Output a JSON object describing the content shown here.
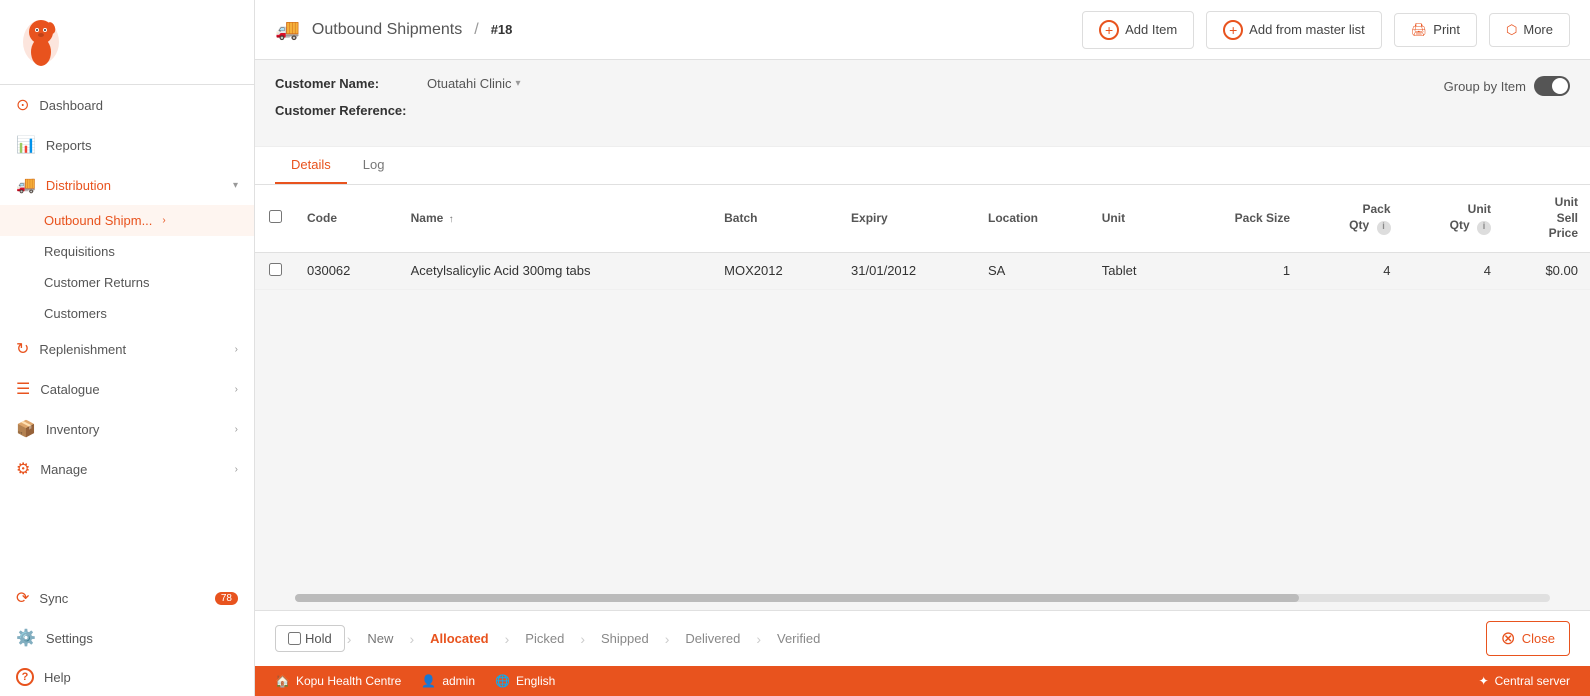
{
  "app": {
    "logo_alt": "mSupply logo"
  },
  "sidebar": {
    "items": [
      {
        "id": "dashboard",
        "label": "Dashboard",
        "icon": "⊙",
        "active": false
      },
      {
        "id": "reports",
        "label": "Reports",
        "icon": "📊",
        "active": false
      },
      {
        "id": "distribution",
        "label": "Distribution",
        "icon": "🚚",
        "active": true,
        "expanded": true
      },
      {
        "id": "replenishment",
        "label": "Replenishment",
        "icon": "🔄",
        "active": false
      },
      {
        "id": "catalogue",
        "label": "Catalogue",
        "icon": "☰",
        "active": false
      },
      {
        "id": "inventory",
        "label": "Inventory",
        "icon": "📦",
        "active": false
      },
      {
        "id": "manage",
        "label": "Manage",
        "icon": "⚙",
        "active": false
      },
      {
        "id": "sync",
        "label": "Sync",
        "icon": "⟳",
        "active": false,
        "badge": "78"
      },
      {
        "id": "settings",
        "label": "Settings",
        "icon": "⚙️",
        "active": false
      },
      {
        "id": "help",
        "label": "Help",
        "icon": "?",
        "active": false
      }
    ],
    "sub_items": [
      {
        "id": "outbound",
        "label": "Outbound Shipm...",
        "active": true
      },
      {
        "id": "requisitions",
        "label": "Requisitions",
        "active": false
      },
      {
        "id": "customer_returns",
        "label": "Customer Returns",
        "active": false
      },
      {
        "id": "customers",
        "label": "Customers",
        "active": false
      }
    ]
  },
  "header": {
    "breadcrumb_parent": "Outbound Shipments",
    "separator": "/",
    "shipment_id": "#18",
    "buttons": {
      "add_item": "Add Item",
      "add_from_master": "Add from master list",
      "print": "Print",
      "more": "More"
    }
  },
  "form": {
    "customer_name_label": "Customer Name:",
    "customer_name_value": "Otuatahi Clinic",
    "customer_ref_label": "Customer Reference:",
    "group_by_label": "Group by Item"
  },
  "tabs": [
    {
      "id": "details",
      "label": "Details",
      "active": true
    },
    {
      "id": "log",
      "label": "Log",
      "active": false
    }
  ],
  "table": {
    "columns": [
      {
        "id": "checkbox",
        "label": "",
        "type": "checkbox"
      },
      {
        "id": "code",
        "label": "Code"
      },
      {
        "id": "name",
        "label": "Name",
        "sortable": true
      },
      {
        "id": "batch",
        "label": "Batch"
      },
      {
        "id": "expiry",
        "label": "Expiry"
      },
      {
        "id": "location",
        "label": "Location"
      },
      {
        "id": "unit",
        "label": "Unit"
      },
      {
        "id": "pack_size",
        "label": "Pack Size"
      },
      {
        "id": "pack_qty",
        "label": "Pack Qty",
        "info": true
      },
      {
        "id": "unit_qty",
        "label": "Unit Qty",
        "info": true
      },
      {
        "id": "unit_sell_price",
        "label": "Unit Sell Price"
      }
    ],
    "rows": [
      {
        "code": "030062",
        "name": "Acetylsalicylic Acid 300mg tabs",
        "batch": "MOX2012",
        "expiry": "31/01/2012",
        "location": "SA",
        "unit": "Tablet",
        "pack_size": "1",
        "pack_qty": "4",
        "unit_qty": "4",
        "unit_sell_price": "$0.00"
      }
    ]
  },
  "status_pipeline": {
    "hold_label": "Hold",
    "steps": [
      {
        "id": "new",
        "label": "New",
        "state": "completed"
      },
      {
        "id": "allocated",
        "label": "Allocated",
        "state": "active"
      },
      {
        "id": "picked",
        "label": "Picked",
        "state": "default"
      },
      {
        "id": "shipped",
        "label": "Shipped",
        "state": "default"
      },
      {
        "id": "delivered",
        "label": "Delivered",
        "state": "default"
      },
      {
        "id": "verified",
        "label": "Verified",
        "state": "default"
      }
    ],
    "close_label": "Close"
  },
  "footer": {
    "facility": "Kopu Health Centre",
    "user": "admin",
    "language": "English",
    "server": "Central server"
  }
}
